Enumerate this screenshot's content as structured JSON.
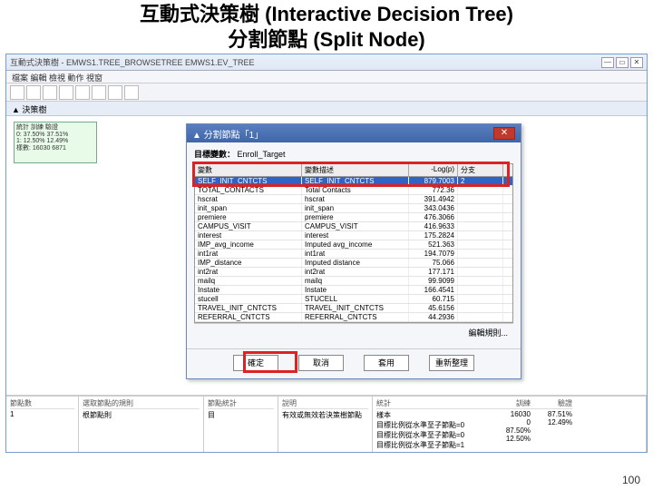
{
  "slide": {
    "title_zh": "互動式決策樹 (Interactive Decision Tree)",
    "subtitle_zh": "分割節點 (Split Node)",
    "page_number": "100"
  },
  "app": {
    "titlebar": "互動式決策樹 - EMWS1.TREE_BROWSETREE EMWS1.EV_TREE",
    "menu": "檔案 編輯 檢視 動作 視窗",
    "inner_tab": "▲ 決策樹"
  },
  "node": {
    "l1": "統計   訓練   驗證",
    "l2": "0:  37.50% 37.51%",
    "l3": "1:  12.50% 12.49%",
    "l4": "樣數:  16030  6871"
  },
  "dialog": {
    "title": "▲ 分割節點「1」",
    "target_label": "目標變數：",
    "target_value": "Enroll_Target",
    "header": {
      "a": "變數",
      "b": "變數描述",
      "c": "-Log(p)",
      "d": "分支"
    },
    "rows": [
      {
        "a": "SELF_INIT_CNTCTS",
        "b": "SELF_INIT_CNTCTS",
        "c": "879.7003",
        "d": "2",
        "sel": true
      },
      {
        "a": "TOTAL_CONTACTS",
        "b": "Total Contacts",
        "c": "772.36",
        "d": ""
      },
      {
        "a": "hscrat",
        "b": "hscrat",
        "c": "391.4942",
        "d": ""
      },
      {
        "a": "init_span",
        "b": "init_span",
        "c": "343.0436",
        "d": ""
      },
      {
        "a": "premiere",
        "b": "premiere",
        "c": "476.3066",
        "d": ""
      },
      {
        "a": "CAMPUS_VISIT",
        "b": "CAMPUS_VISIT",
        "c": "416.9633",
        "d": ""
      },
      {
        "a": "interest",
        "b": "interest",
        "c": "175.2824",
        "d": ""
      },
      {
        "a": "IMP_avg_income",
        "b": "Imputed avg_income",
        "c": "521.363",
        "d": ""
      },
      {
        "a": "int1rat",
        "b": "int1rat",
        "c": "194.7079",
        "d": ""
      },
      {
        "a": "IMP_distance",
        "b": "Imputed distance",
        "c": "75.066",
        "d": ""
      },
      {
        "a": "int2rat",
        "b": "int2rat",
        "c": "177.171",
        "d": ""
      },
      {
        "a": "mailq",
        "b": "mailq",
        "c": "99.9099",
        "d": ""
      },
      {
        "a": "Instate",
        "b": "Instate",
        "c": "166.4541",
        "d": ""
      },
      {
        "a": "stucell",
        "b": "STUCELL",
        "c": "60.715",
        "d": ""
      },
      {
        "a": "TRAVEL_INIT_CNTCTS",
        "b": "TRAVEL_INIT_CNTCTS",
        "c": "45.6156",
        "d": ""
      },
      {
        "a": "REFERRAL_CNTCTS",
        "b": "REFERRAL_CNTCTS",
        "c": "44.2936",
        "d": ""
      }
    ],
    "edit_rule": "編輯規則...",
    "buttons": {
      "ok": "確定",
      "cancel": "取消",
      "apply": "套用",
      "reset": "重新整理"
    }
  },
  "status": {
    "c1h": "節點數",
    "c1v": "1",
    "c2h": "選取節點的規則",
    "c2v": "根節點則",
    "c3h": "節點統計",
    "c3v": "目",
    "c4h": "說明",
    "c4v": "有效或無效若決策樹節點",
    "c5h": "統計",
    "c5h2": "訓練",
    "c5h3": "驗證",
    "r1": "樣本",
    "r1a": "16030",
    "r1b": "",
    "r2": "目標比例從水準至子節點=0",
    "r2a": "0",
    "r2b": "",
    "r3": "目標比例從水準至子節點=0",
    "r3a": "87.50%",
    "r3b": "87.51%",
    "r4": "目標比例從水準至子節點=1",
    "r4a": "12.50%",
    "r4b": "12.49%"
  }
}
